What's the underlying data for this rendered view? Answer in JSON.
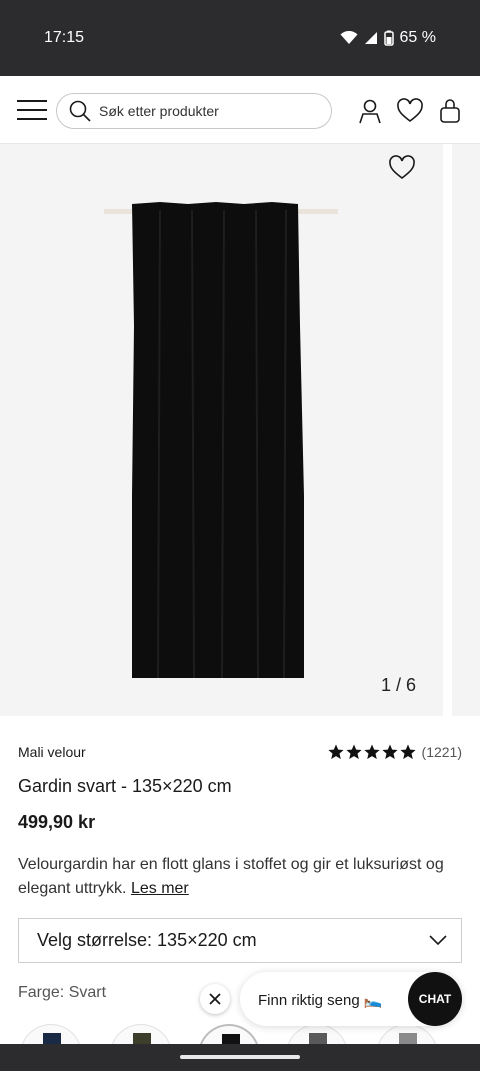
{
  "status_bar": {
    "time": "17:15",
    "battery": "65 %"
  },
  "header": {
    "search_placeholder": "Søk etter produkter"
  },
  "gallery": {
    "counter": "1 / 6"
  },
  "product": {
    "brand": "Mali velour",
    "rating_stars": 5,
    "review_count": "(1221)",
    "title": "Gardin svart - 135×220 cm",
    "price": "499,90 kr",
    "description": "Velourgardin har en flott glans i stoffet og gir et luksuriøst og elegant uttrykk.",
    "read_more": "Les mer",
    "size_select": "Velg størrelse: 135×220 cm",
    "color_label": "Farge:",
    "color_value": "Svart",
    "swatch_colors": [
      "#1b2a44",
      "#3d3f2c",
      "#111111",
      "#5a5a5a",
      "#8a8a8a"
    ]
  },
  "chat": {
    "prompt": "Finn riktig seng 🛌",
    "button": "CHAT"
  },
  "colors": {
    "statusbar": "#2c2c2e",
    "gallery_bg": "#f4f4f4",
    "accent": "#111111"
  }
}
